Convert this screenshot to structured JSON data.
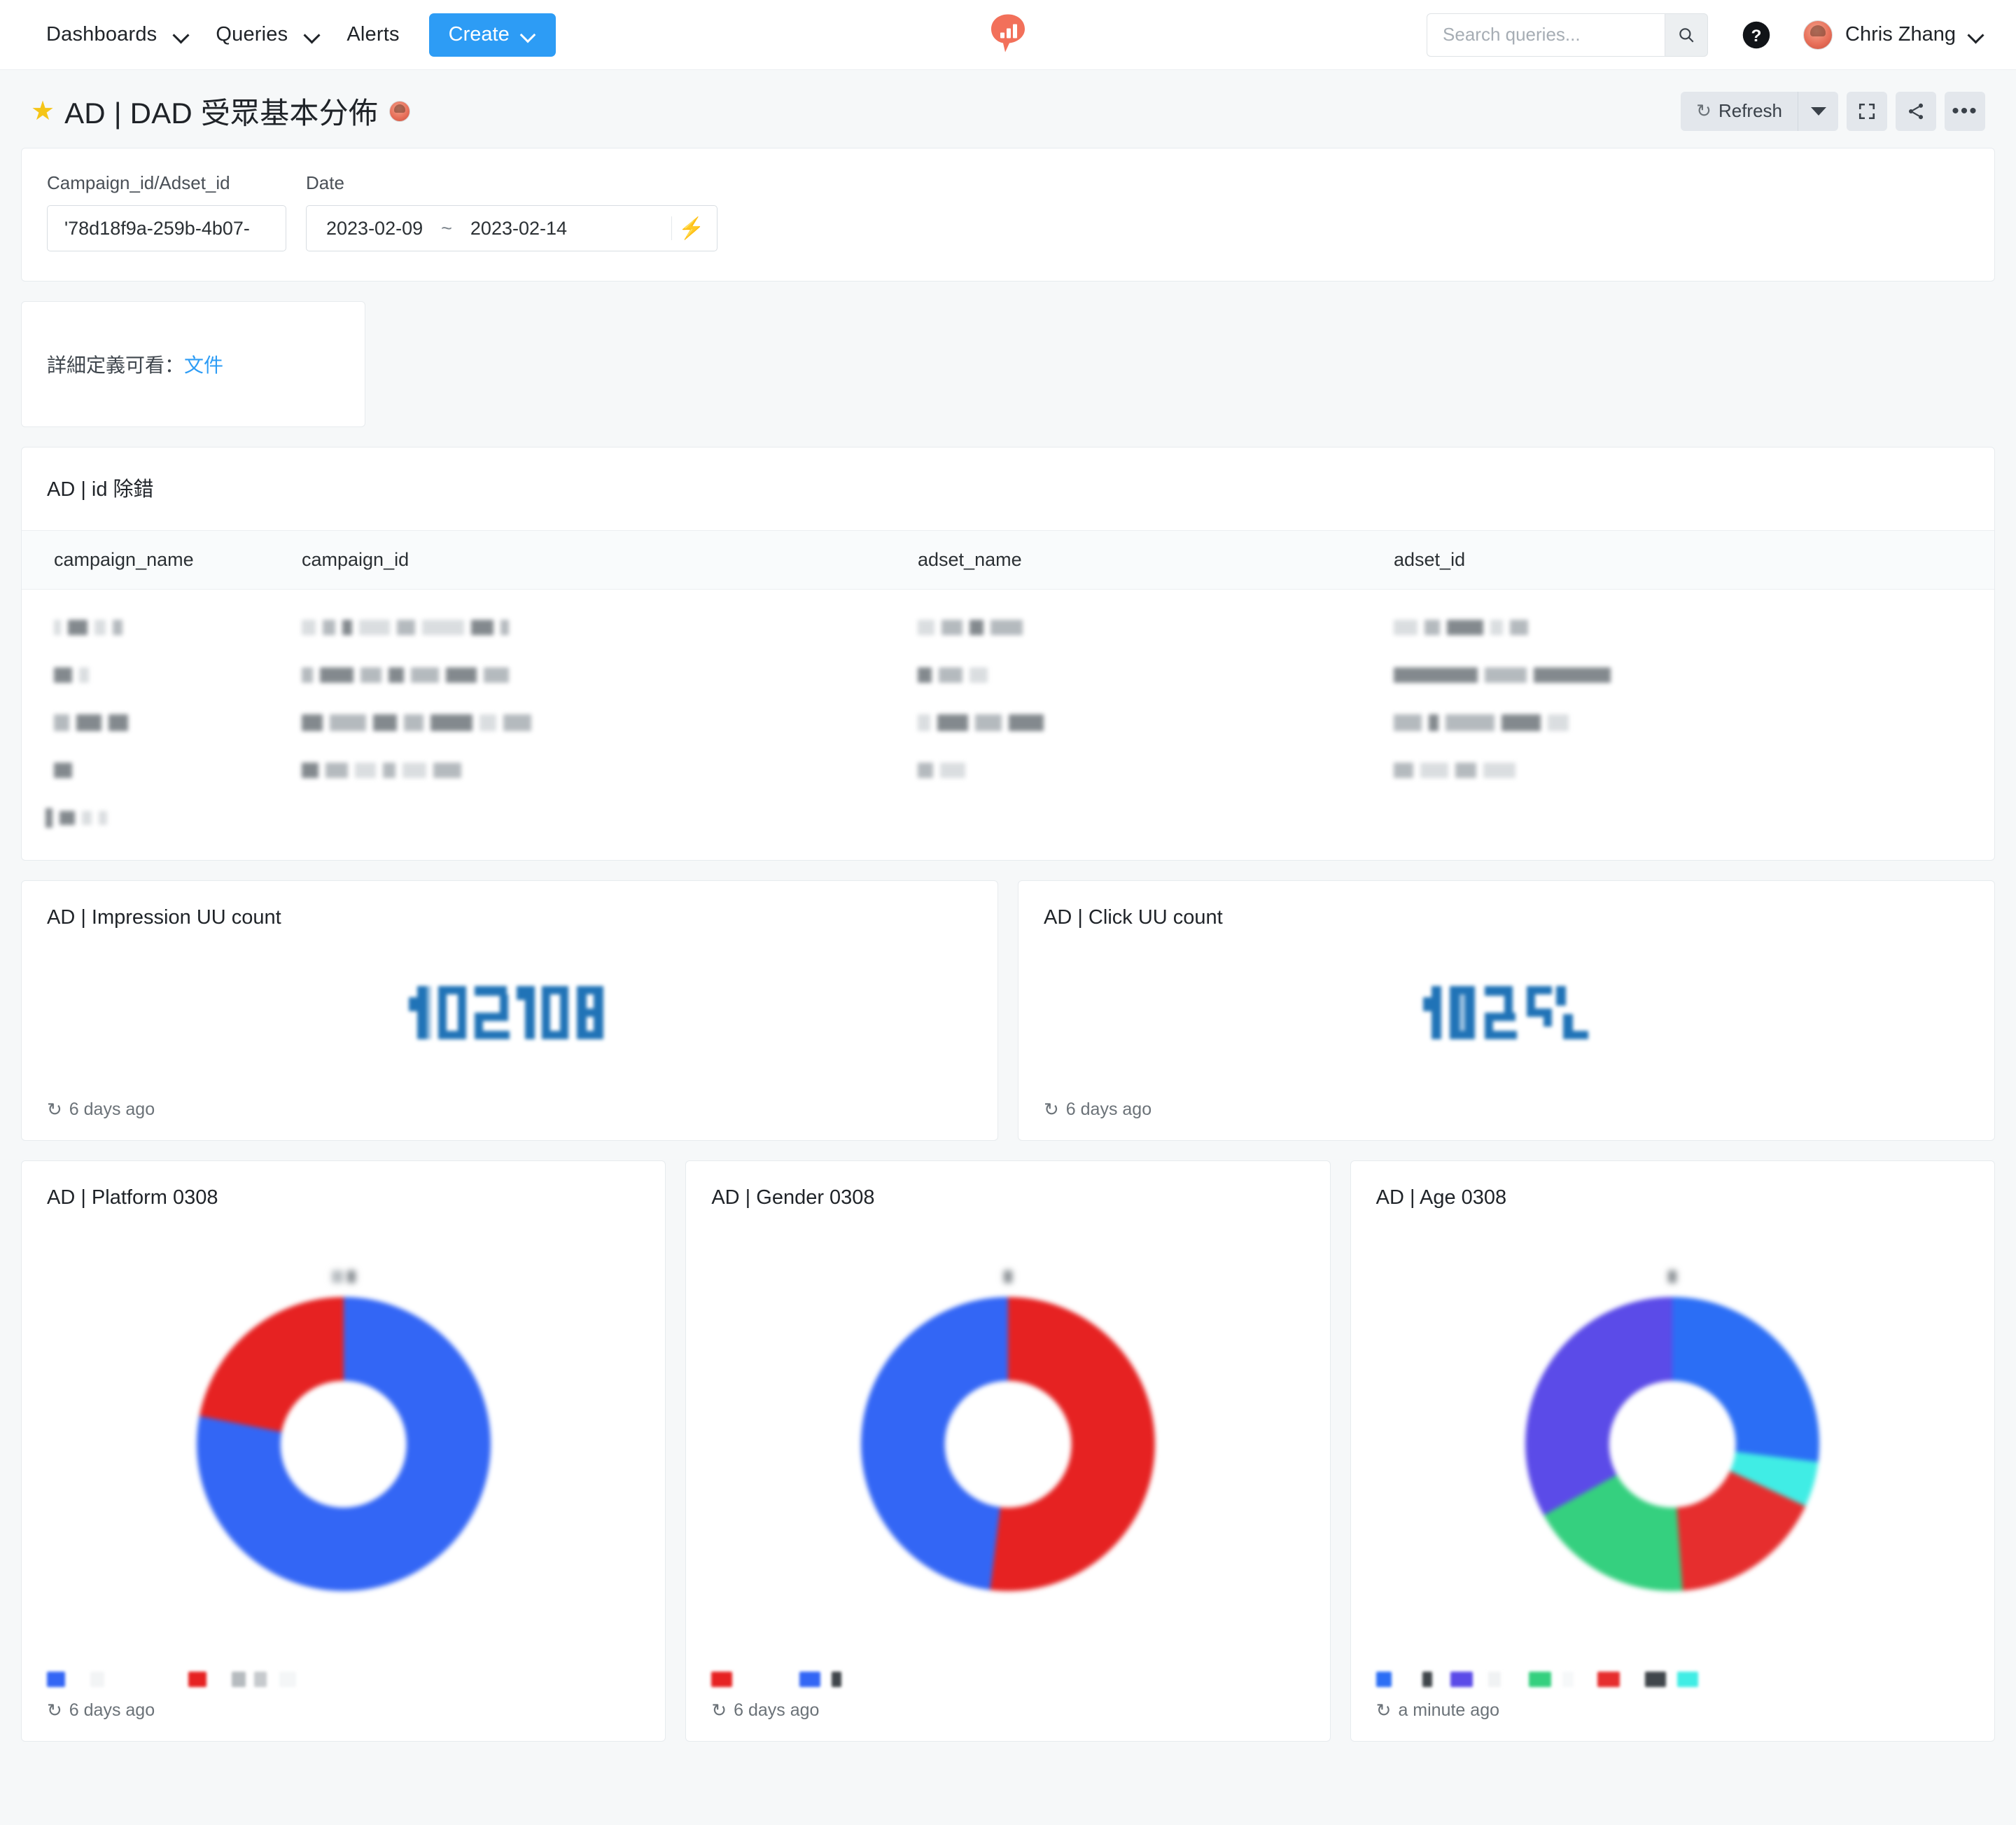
{
  "nav": {
    "items": [
      {
        "label": "Dashboards",
        "has_caret": true
      },
      {
        "label": "Queries",
        "has_caret": true
      },
      {
        "label": "Alerts",
        "has_caret": false
      }
    ],
    "create_label": "Create",
    "logo_icon": "redash-bar-chart-bubble-logo",
    "logo_color": "#f2705a"
  },
  "search": {
    "placeholder": "Search queries...",
    "value": "",
    "icon": "search-icon"
  },
  "user": {
    "name": "Chris Zhang",
    "help_icon": "help-circle-icon",
    "avatar_icon": "user-avatar"
  },
  "header": {
    "star_icon": "star-icon",
    "title": "AD | DAD 受眾基本分佈",
    "owner_avatar": "dashboard-owner-avatar",
    "actions": {
      "refresh_label": "Refresh",
      "refresh_icon": "refresh-icon",
      "refresh_caret_icon": "caret-down-icon",
      "fullscreen_icon": "fullscreen-icon",
      "share_icon": "share-icon",
      "more_icon": "more-horizontal-icon"
    }
  },
  "filters": {
    "campaign": {
      "label": "Campaign_id/Adset_id",
      "value": "'78d18f9a-259b-4b07-"
    },
    "date": {
      "label": "Date",
      "start": "2023-02-09",
      "separator": "~",
      "end": "2023-02-14",
      "action_icon": "lightning-icon"
    }
  },
  "text_widget": {
    "prefix": "詳細定義可看：",
    "link_label": "文件",
    "link_color": "#2d9cf5"
  },
  "table_widget": {
    "title": "AD | id 除錯",
    "columns": [
      "campaign_name",
      "campaign_id",
      "adset_name",
      "adset_id"
    ],
    "rows_redacted": true,
    "row_count": 5
  },
  "counters": [
    {
      "title": "AD | Impression UU count",
      "value_redacted": true,
      "value_digits": 7,
      "value_color": "#2073b7",
      "footer": "6 days ago",
      "footer_icon": "refresh-icon"
    },
    {
      "title": "AD | Click UU count",
      "value_redacted": true,
      "value_digits": 6,
      "value_color": "#2073b7",
      "footer": "6 days ago",
      "footer_icon": "refresh-icon"
    }
  ],
  "charts": [
    {
      "title": "AD | Platform 0308",
      "footer": "6 days ago",
      "footer_icon": "refresh-icon",
      "labels_redacted": true
    },
    {
      "title": "AD | Gender 0308",
      "footer": "6 days ago",
      "footer_icon": "refresh-icon",
      "labels_redacted": true
    },
    {
      "title": "AD | Age 0308",
      "footer": "a minute ago",
      "footer_icon": "refresh-icon",
      "labels_redacted": true
    }
  ],
  "chart_data": [
    {
      "type": "pie",
      "title": "AD | Platform 0308",
      "categories": [
        "[redacted]",
        "[redacted]"
      ],
      "values": [
        78,
        22
      ],
      "colors": [
        "#3366f5",
        "#e62222"
      ],
      "legend": "bottom",
      "donut": true,
      "labels_redacted": true
    },
    {
      "type": "pie",
      "title": "AD | Gender 0308",
      "categories": [
        "[redacted]",
        "[redacted]"
      ],
      "values": [
        52,
        48
      ],
      "colors": [
        "#e62222",
        "#3366f5"
      ],
      "legend": "bottom",
      "donut": true,
      "labels_redacted": true
    },
    {
      "type": "pie",
      "title": "AD | Age 0308",
      "categories": [
        "[redacted]",
        "[redacted]",
        "[redacted]",
        "[redacted]",
        "[redacted]"
      ],
      "values": [
        27,
        33,
        18,
        17,
        5
      ],
      "colors": [
        "#2b6ef5",
        "#5b4be8",
        "#35d07f",
        "#e62e2e",
        "#40ede5"
      ],
      "legend": "bottom",
      "donut": true,
      "labels_redacted": true
    }
  ]
}
